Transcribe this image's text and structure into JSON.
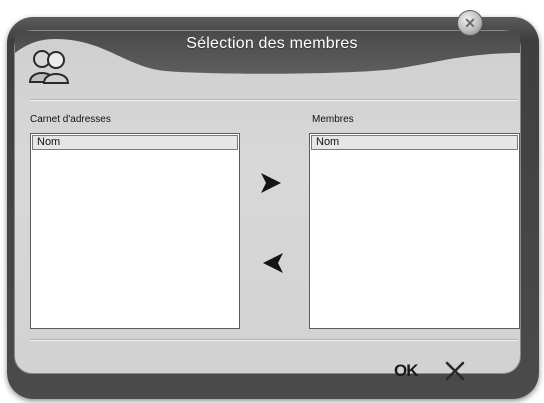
{
  "dialog": {
    "title": "Sélection des membres",
    "close_icon": "close-icon",
    "users_icon": "users-icon"
  },
  "address_book": {
    "label": "Carnet d'adresses",
    "column_header": "Nom",
    "items": []
  },
  "members": {
    "label": "Membres",
    "column_header": "Nom",
    "items": []
  },
  "actions": {
    "add_icon": "arrow-right-icon",
    "remove_icon": "arrow-left-icon",
    "ok_label": "OK",
    "cancel_icon": "cancel-x-icon"
  }
}
